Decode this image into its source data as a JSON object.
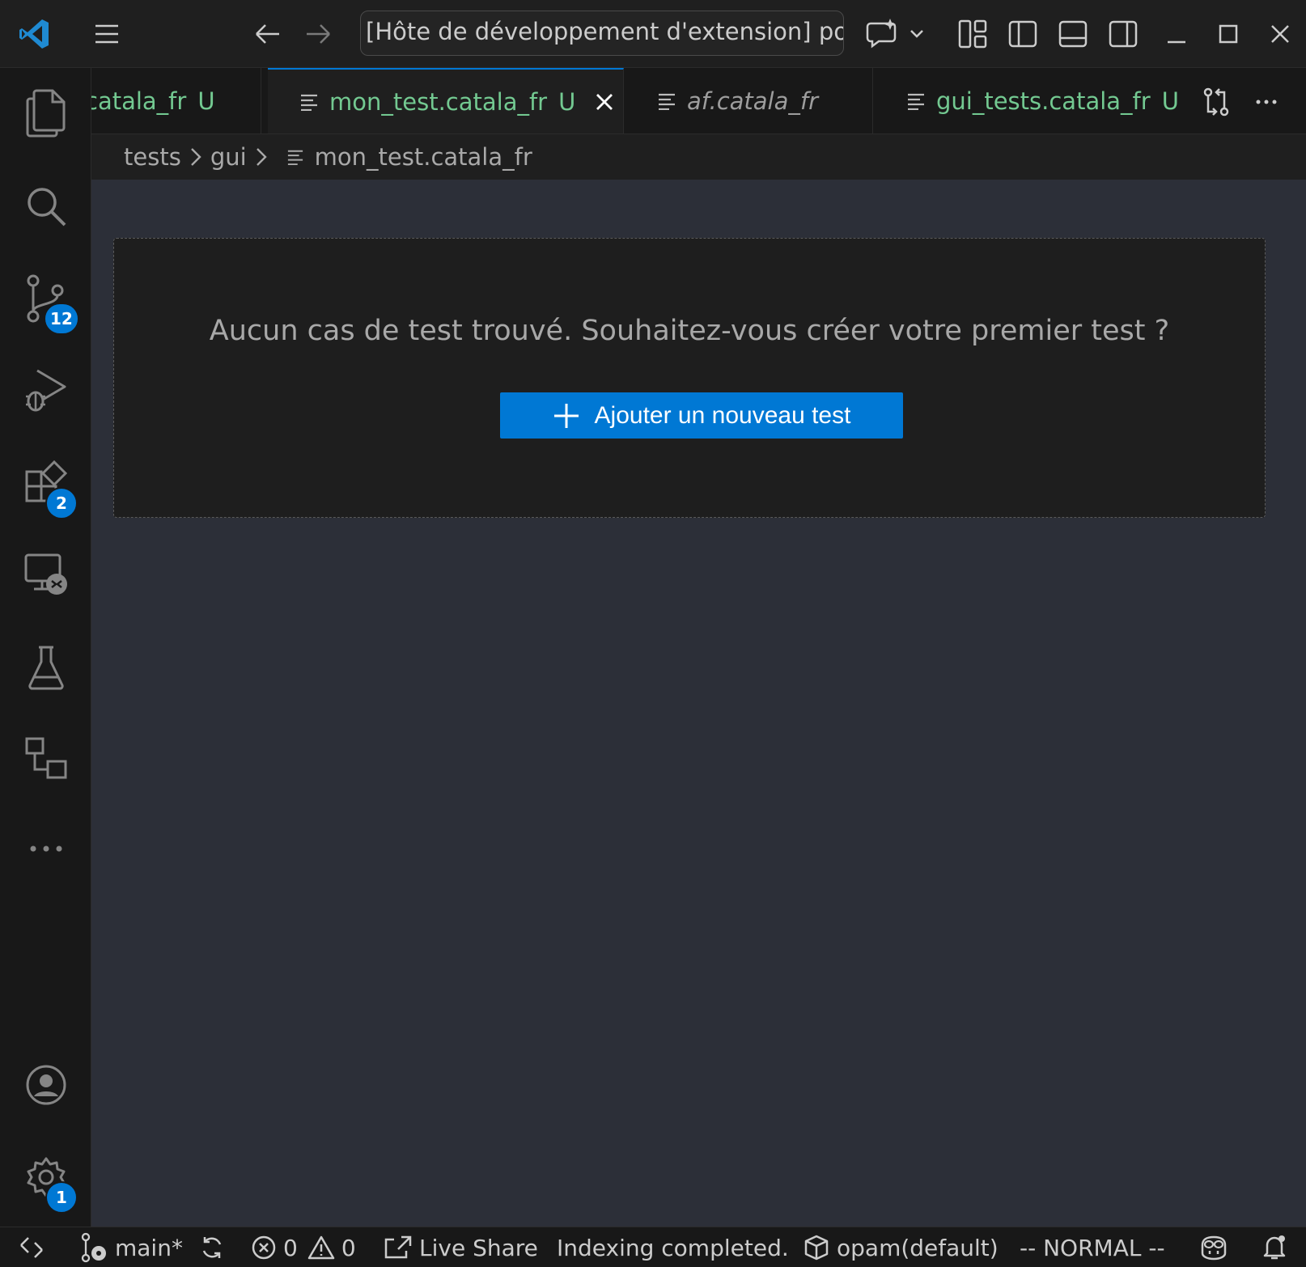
{
  "titlebar": {
    "command_center_text": "[Hôte de développement d'extension] poc-catala",
    "nav_back_label": "Back",
    "nav_forward_label": "Forward"
  },
  "activity_bar": {
    "items": [
      {
        "name": "explorer",
        "icon": "files-icon"
      },
      {
        "name": "search",
        "icon": "search-icon"
      },
      {
        "name": "source-control",
        "icon": "source-control-icon",
        "badge": "12"
      },
      {
        "name": "run-debug",
        "icon": "run-debug-icon"
      },
      {
        "name": "extensions",
        "icon": "extensions-icon",
        "badge": "2"
      },
      {
        "name": "remote-explorer",
        "icon": "remote-explorer-icon"
      },
      {
        "name": "testing",
        "icon": "flask-icon"
      },
      {
        "name": "workflow",
        "icon": "workflow-icon"
      },
      {
        "name": "more",
        "icon": "ellipsis-icon"
      }
    ],
    "bottom": {
      "accounts_icon": "account-icon",
      "settings_icon": "gear-icon",
      "settings_badge": "1"
    }
  },
  "tabs": [
    {
      "label": "catala_fr",
      "status": "U",
      "active": false,
      "italic": false
    },
    {
      "label": "mon_test.catala_fr",
      "status": "U",
      "active": true,
      "italic": false
    },
    {
      "label": "af.catala_fr",
      "status": "",
      "active": false,
      "italic": true
    },
    {
      "label": "gui_tests.catala_fr",
      "status": "U",
      "active": false,
      "italic": false
    }
  ],
  "breadcrumb": {
    "segments": [
      "tests",
      "gui"
    ],
    "file": "mon_test.catala_fr"
  },
  "editor": {
    "empty_message": "Aucun cas de test trouvé. Souhaitez-vous créer votre premier test ?",
    "add_button_label": "Ajouter un nouveau test"
  },
  "statusbar": {
    "branch": "main*",
    "errors": "0",
    "warnings": "0",
    "live_share": "Live Share",
    "indexing": "Indexing completed.",
    "opam": "opam(default)",
    "vim_mode": "-- NORMAL --"
  },
  "colors": {
    "accent": "#0078d4",
    "untracked_green": "#73c991",
    "editor_bg": "#2c2f38",
    "chrome_bg": "#181818"
  }
}
